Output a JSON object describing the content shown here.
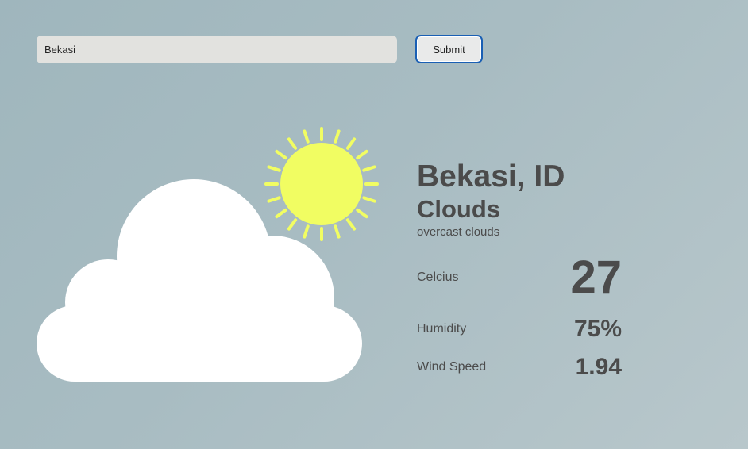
{
  "search": {
    "value": "Bekasi"
  },
  "submit": {
    "label": "Submit"
  },
  "weather": {
    "icon": "cloud-sun-icon",
    "location": "Bekasi, ID",
    "main": "Clouds",
    "description": "overcast clouds"
  },
  "stats": {
    "celcius_label": "Celcius",
    "celcius_value": "27",
    "humidity_label": "Humidity",
    "humidity_value": "75%",
    "wind_label": "Wind Speed",
    "wind_value": "1.94"
  },
  "colors": {
    "sun": "#f1fd62",
    "cloud": "#ffffff",
    "text": "#4b4b4b",
    "submit_border": "#1a5fb4"
  }
}
